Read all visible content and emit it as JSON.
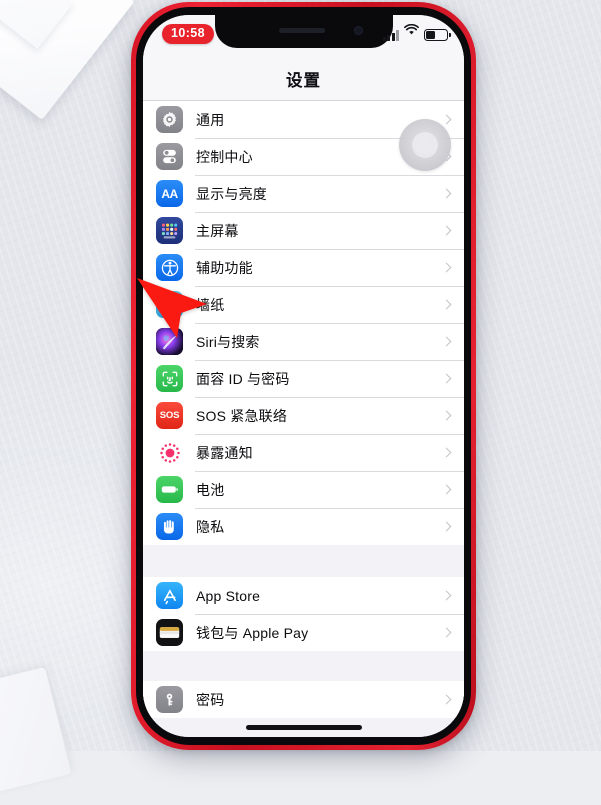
{
  "status_bar": {
    "time": "10:58",
    "signal_icon": "cellular-signal-icon",
    "wifi_icon": "wifi-icon",
    "battery_icon": "battery-icon"
  },
  "nav": {
    "title": "设置"
  },
  "overlays": {
    "assistive_touch": "assistive-touch-button",
    "cursor": "red-pointer-cursor"
  },
  "colors": {
    "phone_frame": "#e52232",
    "bezel": "#0a0a0c",
    "screen_bg": "#f2f2f7",
    "row_bg": "#ffffff",
    "separator": "#d9d9de",
    "chevron": "#c3c3c8",
    "time_pill": "#e8232c",
    "icon_gray": "#8e8e93",
    "icon_blue": "#1c7cf2",
    "icon_green": "#34c759",
    "icon_red": "#ff3b30",
    "icon_lightblue": "#45b5e8",
    "icon_darkblue": "#1f3a93"
  },
  "sections": [
    {
      "id": "system-group",
      "items": [
        {
          "label": "通用",
          "icon": "gear-icon"
        },
        {
          "label": "控制中心",
          "icon": "control-center-icon"
        },
        {
          "label": "显示与亮度",
          "icon": "display-brightness-icon"
        },
        {
          "label": "主屏幕",
          "icon": "home-screen-icon"
        },
        {
          "label": "辅助功能",
          "icon": "accessibility-icon"
        },
        {
          "label": "墙纸",
          "icon": "wallpaper-icon"
        },
        {
          "label": "Siri与搜索",
          "icon": "siri-icon"
        },
        {
          "label": "面容 ID 与密码",
          "icon": "face-id-icon"
        },
        {
          "label": "SOS 紧急联络",
          "icon": "sos-icon"
        },
        {
          "label": "暴露通知",
          "icon": "exposure-notification-icon"
        },
        {
          "label": "电池",
          "icon": "battery-settings-icon"
        },
        {
          "label": "隐私",
          "icon": "privacy-hand-icon"
        }
      ]
    },
    {
      "id": "store-group",
      "items": [
        {
          "label": "App Store",
          "icon": "app-store-icon"
        },
        {
          "label": "钱包与 Apple Pay",
          "icon": "wallet-icon"
        }
      ]
    },
    {
      "id": "passwords-group",
      "items": [
        {
          "label": "密码",
          "icon": "passwords-key-icon"
        }
      ]
    }
  ]
}
